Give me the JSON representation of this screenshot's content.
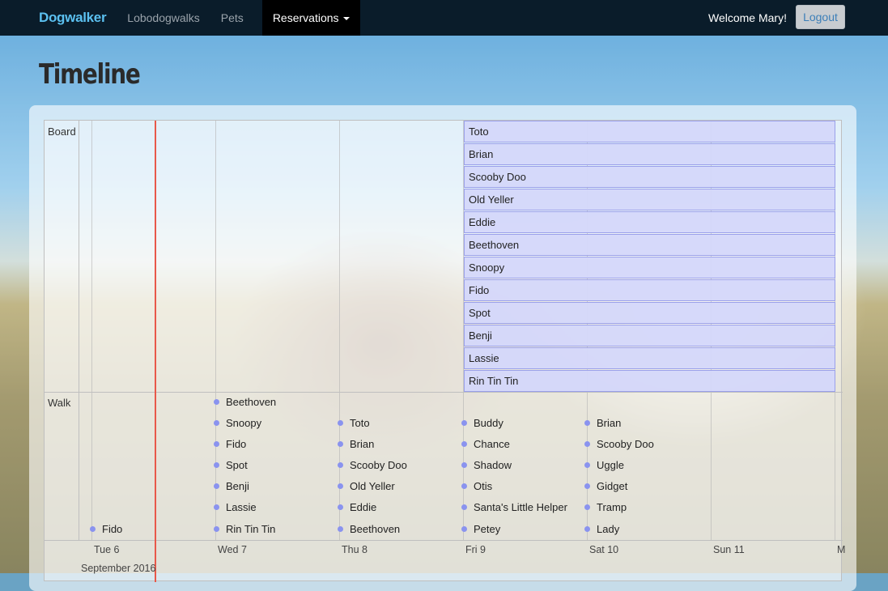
{
  "navbar": {
    "brand": "Dogwalker",
    "links": [
      "Lobodogwalks",
      "Pets"
    ],
    "active": "Reservations",
    "welcome": "Welcome Mary!",
    "logout": "Logout"
  },
  "page_title": "Timeline",
  "timeline": {
    "groups": [
      "Board",
      "Walk"
    ],
    "board": [
      "Toto",
      "Brian",
      "Scooby Doo",
      "Old Yeller",
      "Eddie",
      "Beethoven",
      "Snoopy",
      "Fido",
      "Spot",
      "Benji",
      "Lassie",
      "Rin Tin Tin"
    ],
    "walk": {
      "tue": [
        "Fido"
      ],
      "wed": [
        "Beethoven",
        "Snoopy",
        "Fido",
        "Spot",
        "Benji",
        "Lassie",
        "Rin Tin Tin"
      ],
      "thu": [
        "Toto",
        "Brian",
        "Scooby Doo",
        "Old Yeller",
        "Eddie",
        "Beethoven"
      ],
      "fri": [
        "Buddy",
        "Chance",
        "Shadow",
        "Otis",
        "Santa's Little Helper",
        "Petey"
      ],
      "sat": [
        "Brian",
        "Scooby Doo",
        "Uggle",
        "Gidget",
        "Tramp",
        "Lady"
      ]
    },
    "axis": [
      "Tue 6",
      "Wed 7",
      "Thu 8",
      "Fri 9",
      "Sat 10",
      "Sun 11",
      "M"
    ],
    "month": "September 2016"
  },
  "colors": {
    "navbar": "#0a1c2a",
    "brand": "#5bc0f0",
    "now_line": "#e8584a",
    "board_item": "#d4d7fa",
    "dot": "#8a93ef"
  }
}
